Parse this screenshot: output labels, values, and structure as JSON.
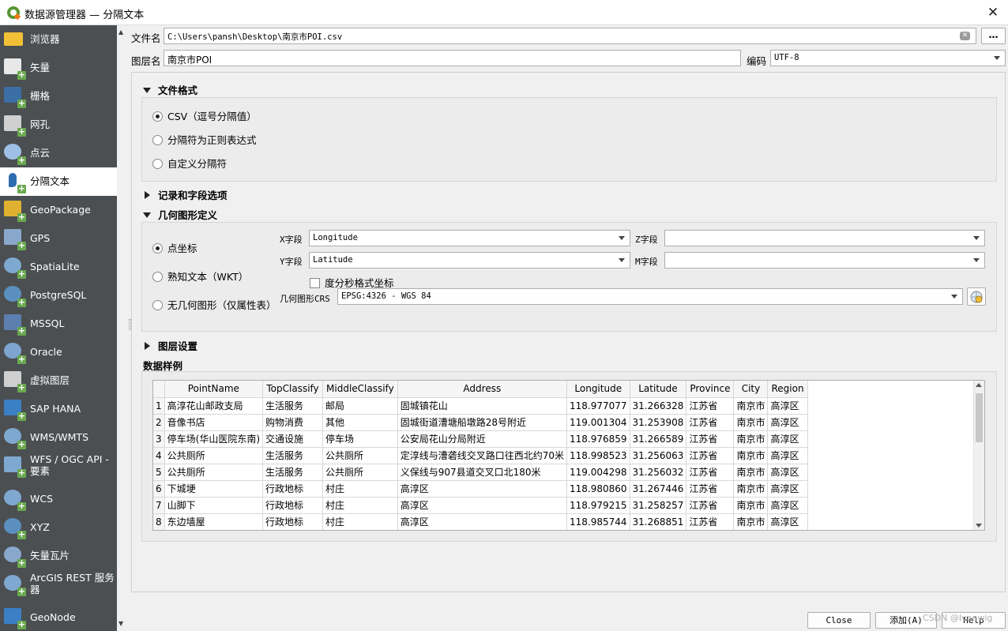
{
  "window": {
    "title": "数据源管理器 — 分隔文本",
    "close_glyph": "✕"
  },
  "sidebar": {
    "items": [
      {
        "label": "浏览器",
        "icon": "folder-icon"
      },
      {
        "label": "矢量",
        "icon": "vector-icon"
      },
      {
        "label": "栅格",
        "icon": "raster-icon"
      },
      {
        "label": "网孔",
        "icon": "mesh-icon"
      },
      {
        "label": "点云",
        "icon": "point-cloud-icon"
      },
      {
        "label": "分隔文本",
        "icon": "delimited-text-icon"
      },
      {
        "label": "GeoPackage",
        "icon": "geopackage-icon"
      },
      {
        "label": "GPS",
        "icon": "gps-icon"
      },
      {
        "label": "SpatiaLite",
        "icon": "spatialite-icon"
      },
      {
        "label": "PostgreSQL",
        "icon": "postgresql-icon"
      },
      {
        "label": "MSSQL",
        "icon": "mssql-icon"
      },
      {
        "label": "Oracle",
        "icon": "oracle-icon"
      },
      {
        "label": "虚拟图层",
        "icon": "virtual-layer-icon"
      },
      {
        "label": "SAP HANA",
        "icon": "sap-hana-icon"
      },
      {
        "label": "WMS/WMTS",
        "icon": "wms-icon"
      },
      {
        "label": "WFS / OGC API - 要素",
        "icon": "wfs-icon"
      },
      {
        "label": "WCS",
        "icon": "wcs-icon"
      },
      {
        "label": "XYZ",
        "icon": "xyz-icon"
      },
      {
        "label": "矢量瓦片",
        "icon": "vector-tile-icon"
      },
      {
        "label": "ArcGIS REST 服务器",
        "icon": "arcgis-icon"
      },
      {
        "label": "GeoNode",
        "icon": "geonode-icon"
      }
    ],
    "active_index": 5
  },
  "file": {
    "label": "文件名",
    "path": "C:\\Users\\pansh\\Desktop\\南京市POI.csv",
    "browse_label": "…"
  },
  "layer": {
    "label": "图层名",
    "name": "南京市POI",
    "encoding_label": "编码",
    "encoding": "UTF-8"
  },
  "file_format": {
    "title": "文件格式",
    "options": [
      "CSV（逗号分隔值）",
      "分隔符为正则表达式",
      "自定义分隔符"
    ],
    "selected": 0
  },
  "record_options": {
    "title": "记录和字段选项"
  },
  "geometry": {
    "title": "几何图形定义",
    "options": [
      "点坐标",
      "熟知文本（WKT）",
      "无几何图形（仅属性表）"
    ],
    "selected": 0,
    "x_label": "X字段",
    "x_value": "Longitude",
    "y_label": "Y字段",
    "y_value": "Latitude",
    "z_label": "Z字段",
    "z_value": "",
    "m_label": "M字段",
    "m_value": "",
    "dms_label": "度分秒格式坐标",
    "crs_label": "几何图形CRS",
    "crs_value": "EPSG:4326 - WGS 84"
  },
  "layer_settings": {
    "title": "图层设置"
  },
  "sample": {
    "title": "数据样例",
    "columns": [
      "PointName",
      "TopClassify",
      "MiddleClassify",
      "Address",
      "Longitude",
      "Latitude",
      "Province",
      "City",
      "Region"
    ],
    "rows": [
      [
        "1",
        "高淳花山邮政支局",
        "生活服务",
        "邮局",
        "固城镇花山",
        "118.977077",
        "31.266328",
        "江苏省",
        "南京市",
        "高淳区"
      ],
      [
        "2",
        "音像书店",
        "购物消费",
        "其他",
        "固城街道漕塘船墩路28号附近",
        "119.001304",
        "31.253908",
        "江苏省",
        "南京市",
        "高淳区"
      ],
      [
        "3",
        "停车场(华山医院东南)",
        "交通设施",
        "停车场",
        "公安局花山分局附近",
        "118.976859",
        "31.266589",
        "江苏省",
        "南京市",
        "高淳区"
      ],
      [
        "4",
        "公共厕所",
        "生活服务",
        "公共厕所",
        "定淳线与漕砻线交叉路口往西北约70米",
        "118.998523",
        "31.256063",
        "江苏省",
        "南京市",
        "高淳区"
      ],
      [
        "5",
        "公共厕所",
        "生活服务",
        "公共厕所",
        "义保线与907县道交叉口北180米",
        "119.004298",
        "31.256032",
        "江苏省",
        "南京市",
        "高淳区"
      ],
      [
        "6",
        "下城埂",
        "行政地标",
        "村庄",
        "高淳区",
        "118.980860",
        "31.267446",
        "江苏省",
        "南京市",
        "高淳区"
      ],
      [
        "7",
        "山脚下",
        "行政地标",
        "村庄",
        "高淳区",
        "118.979215",
        "31.258257",
        "江苏省",
        "南京市",
        "高淳区"
      ],
      [
        "8",
        "东边墙屋",
        "行政地标",
        "村庄",
        "高淳区",
        "118.985744",
        "31.268851",
        "江苏省",
        "南京市",
        "高淳区"
      ]
    ]
  },
  "footer": {
    "close_label": "Close",
    "add_label": "添加(A)",
    "help_label": "Help"
  },
  "watermark": "CSDN @Ivanwig"
}
